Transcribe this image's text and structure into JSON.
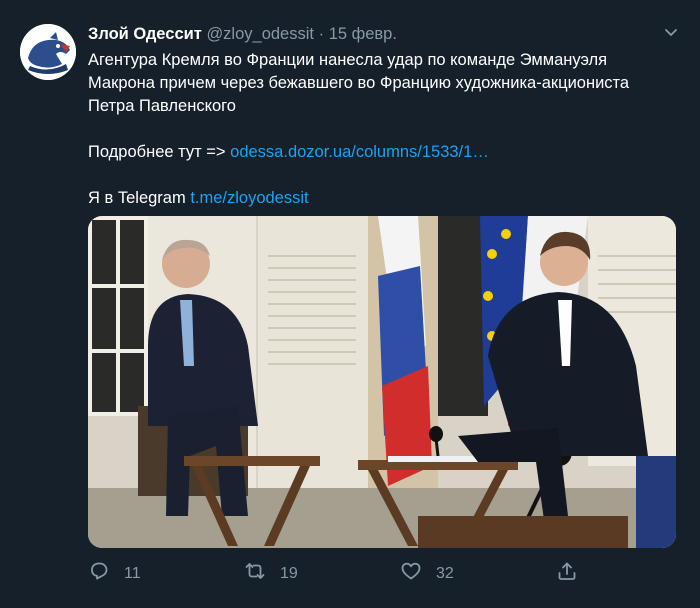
{
  "tweet": {
    "author_name": "Злой Одессит",
    "handle": "@zloy_odessit",
    "separator": "·",
    "date": "15 февр.",
    "text_main": "Агентура Кремля во Франции нанесла удар по команде Эммануэля Макрона причем через бежавшего во Францию художника-акциониста Петра Павленского",
    "more_label": "Подробнее тут =>",
    "more_link": "odessa.dozor.ua/columns/1533/1…",
    "telegram_label": "Я в Telegram",
    "telegram_link": "t.me/zloyodessit"
  },
  "actions": {
    "reply_count": "11",
    "retweet_count": "19",
    "like_count": "32"
  },
  "icons": {
    "reply": "reply-icon",
    "retweet": "retweet-icon",
    "like": "heart-icon",
    "share": "share-icon",
    "menu": "chevron-down-icon"
  },
  "colors": {
    "background": "#15202b",
    "text": "#ffffff",
    "muted": "#8899a6",
    "link": "#1da1f2"
  }
}
